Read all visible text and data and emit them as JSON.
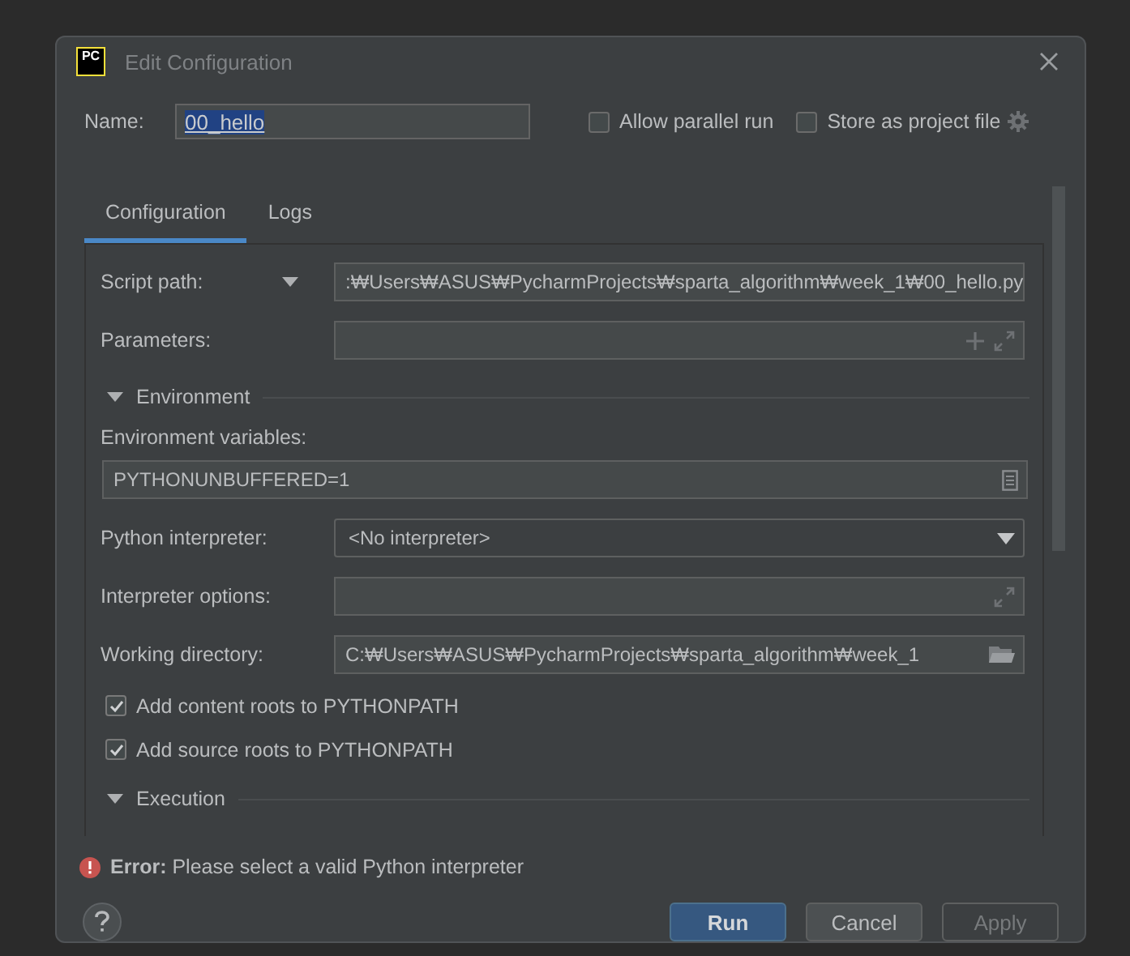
{
  "window": {
    "title": "Edit Configuration",
    "logo": "PC"
  },
  "name": {
    "label": "Name:",
    "value": "00_hello",
    "selected": true
  },
  "options": [
    {
      "label": "Allow parallel run",
      "checked": false
    },
    {
      "label": "Store as project file",
      "checked": false
    }
  ],
  "tabs": [
    {
      "label": "Configuration",
      "selected": true
    },
    {
      "label": "Logs",
      "selected": false
    }
  ],
  "rows": [
    {
      "kind": "script",
      "label": "Script path:",
      "value": ":₩Users₩ASUS₩PycharmProjects₩sparta_algorithm₩week_1₩00_hello.py"
    },
    {
      "kind": "params",
      "label": "Parameters:"
    },
    {
      "kind": "section",
      "label": "Environment",
      "expanded": true
    },
    {
      "kind": "caption",
      "label": "Environment variables:"
    },
    {
      "kind": "env",
      "value": "PYTHONUNBUFFERED=1"
    },
    {
      "kind": "select",
      "label": "Python interpreter:",
      "value": "<No interpreter>"
    },
    {
      "kind": "options",
      "label": "Interpreter options:"
    },
    {
      "kind": "directory",
      "label": "Working directory:",
      "value": "C:₩Users₩ASUS₩PycharmProjects₩sparta_algorithm₩week_1"
    },
    {
      "kind": "checkbox",
      "label": "Add content roots to PYTHONPATH",
      "checked": true
    },
    {
      "kind": "checkbox",
      "label": "Add source roots to PYTHONPATH",
      "checked": true
    },
    {
      "kind": "section",
      "label": "Execution",
      "expanded": true
    }
  ],
  "error": "**Error:** Please select a valid Python interpreter",
  "buttons": [
    {
      "label": "Run",
      "kind": "primary"
    },
    {
      "label": "Cancel",
      "kind": "normal"
    },
    {
      "label": "Apply",
      "kind": "disabled"
    }
  ]
}
